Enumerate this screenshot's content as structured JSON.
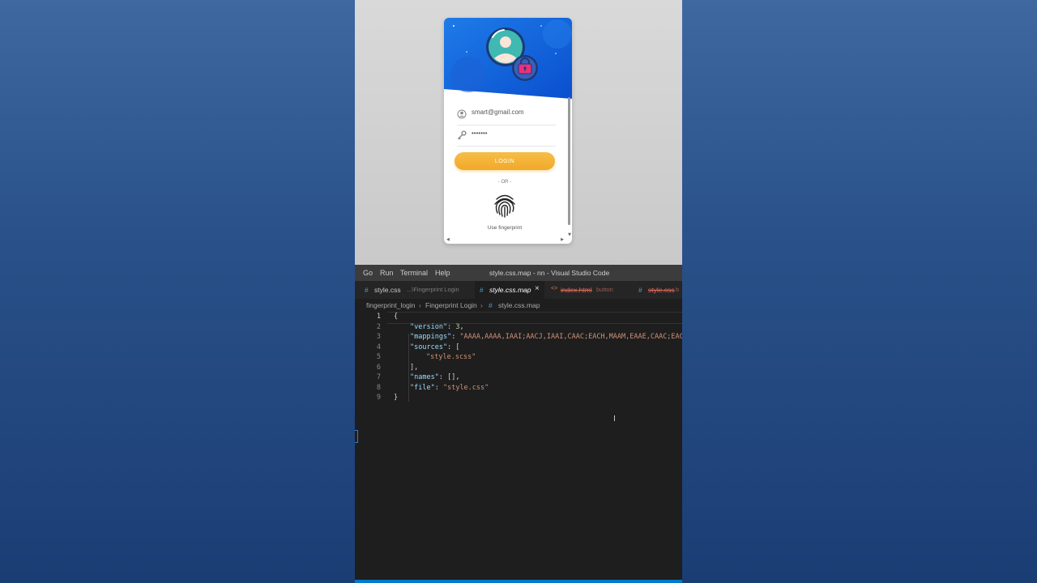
{
  "preview": {
    "login_card": {
      "email_value": "smart@gmail.com",
      "password_value": "•••••••",
      "login_label": "LOGIN",
      "or_text": "- OR -",
      "fingerprint_label": "Use fingerprint"
    },
    "colors": {
      "header_blue": "#1464e0",
      "button_orange": "#f5b13b",
      "avatar_teal": "#3fb9b1",
      "lock_pink": "#e8317a"
    }
  },
  "vscode": {
    "menu": [
      "Go",
      "Run",
      "Terminal",
      "Help"
    ],
    "window_title": "style.css.map - nn - Visual Studio Code",
    "tabs": [
      {
        "icon": "#",
        "name": "style.css",
        "detail": "...\\Fingerprint Login"
      },
      {
        "icon": "#",
        "name": "style.css.map",
        "close": "×"
      },
      {
        "icon": "<>",
        "name": "index.html",
        "detail": "button"
      },
      {
        "icon": "#",
        "name": "style.css",
        "detail": "b"
      }
    ],
    "breadcrumb": [
      "fingerprint_login",
      "Fingerprint Login",
      "style.css.map"
    ],
    "lines": [
      {
        "n": "1",
        "text": "{"
      },
      {
        "n": "2",
        "key": "\"version\"",
        "val": "3"
      },
      {
        "n": "3",
        "key": "\"mappings\"",
        "val": "\"AAAA,AAAA,IAAI;AACJ,IAAI,CAAC;EACH,MAAM,EAAE,CAAC;EAC"
      },
      {
        "n": "4",
        "key": "\"sources\"",
        "val": "["
      },
      {
        "n": "5",
        "text": "\"style.scss\""
      },
      {
        "n": "6",
        "text": "],"
      },
      {
        "n": "7",
        "key": "\"names\"",
        "val": "[]"
      },
      {
        "n": "8",
        "key": "\"file\"",
        "val": "\"style.css\""
      },
      {
        "n": "9",
        "text": "}"
      }
    ]
  }
}
